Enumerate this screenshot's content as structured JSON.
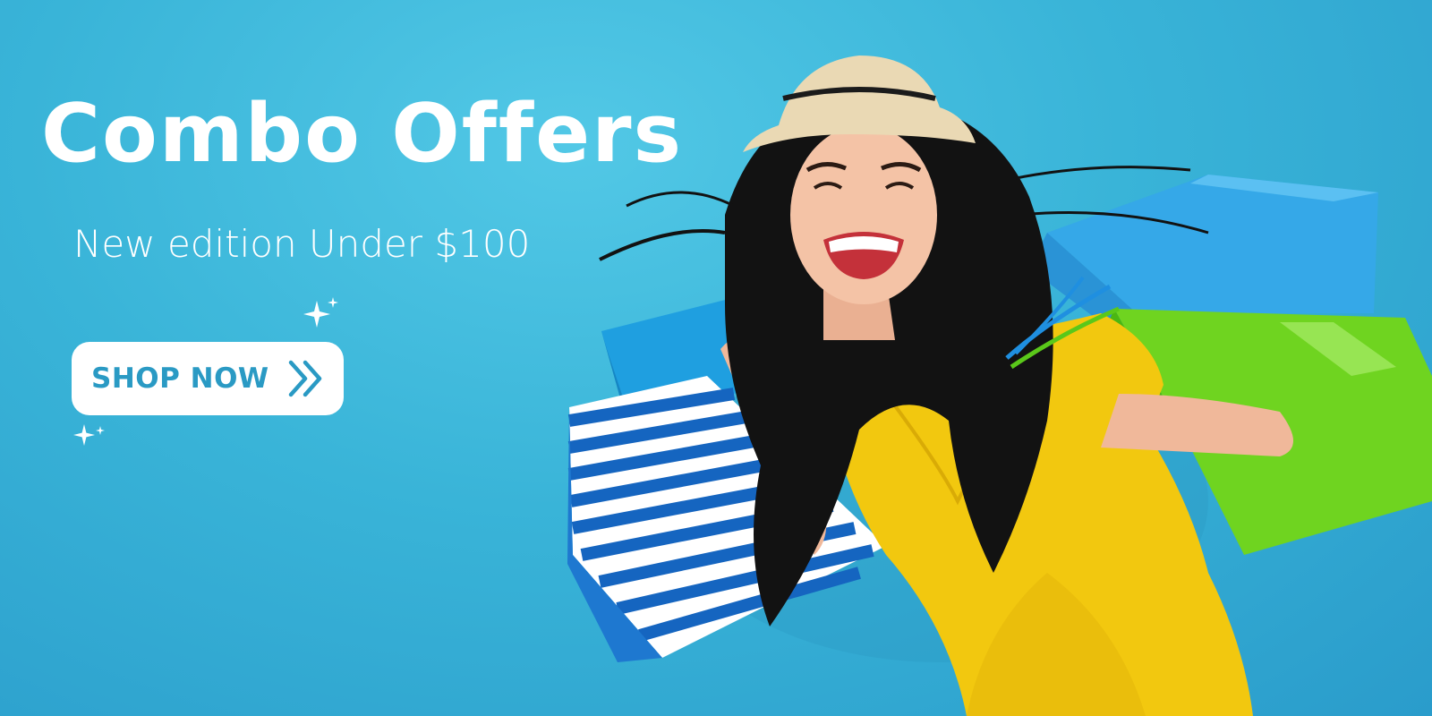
{
  "banner": {
    "headline": "Combo Offers",
    "subtitle": "New edition Under $100",
    "cta": {
      "label": "SHOP NOW",
      "icon": "double-chevron-right-icon"
    },
    "decorations": [
      "sparkle-icon",
      "sparkle-icon"
    ],
    "colors": {
      "background": "#3db8dc",
      "headline": "#ffffff",
      "cta_background": "#ffffff",
      "cta_text": "#2a9ac4"
    }
  }
}
